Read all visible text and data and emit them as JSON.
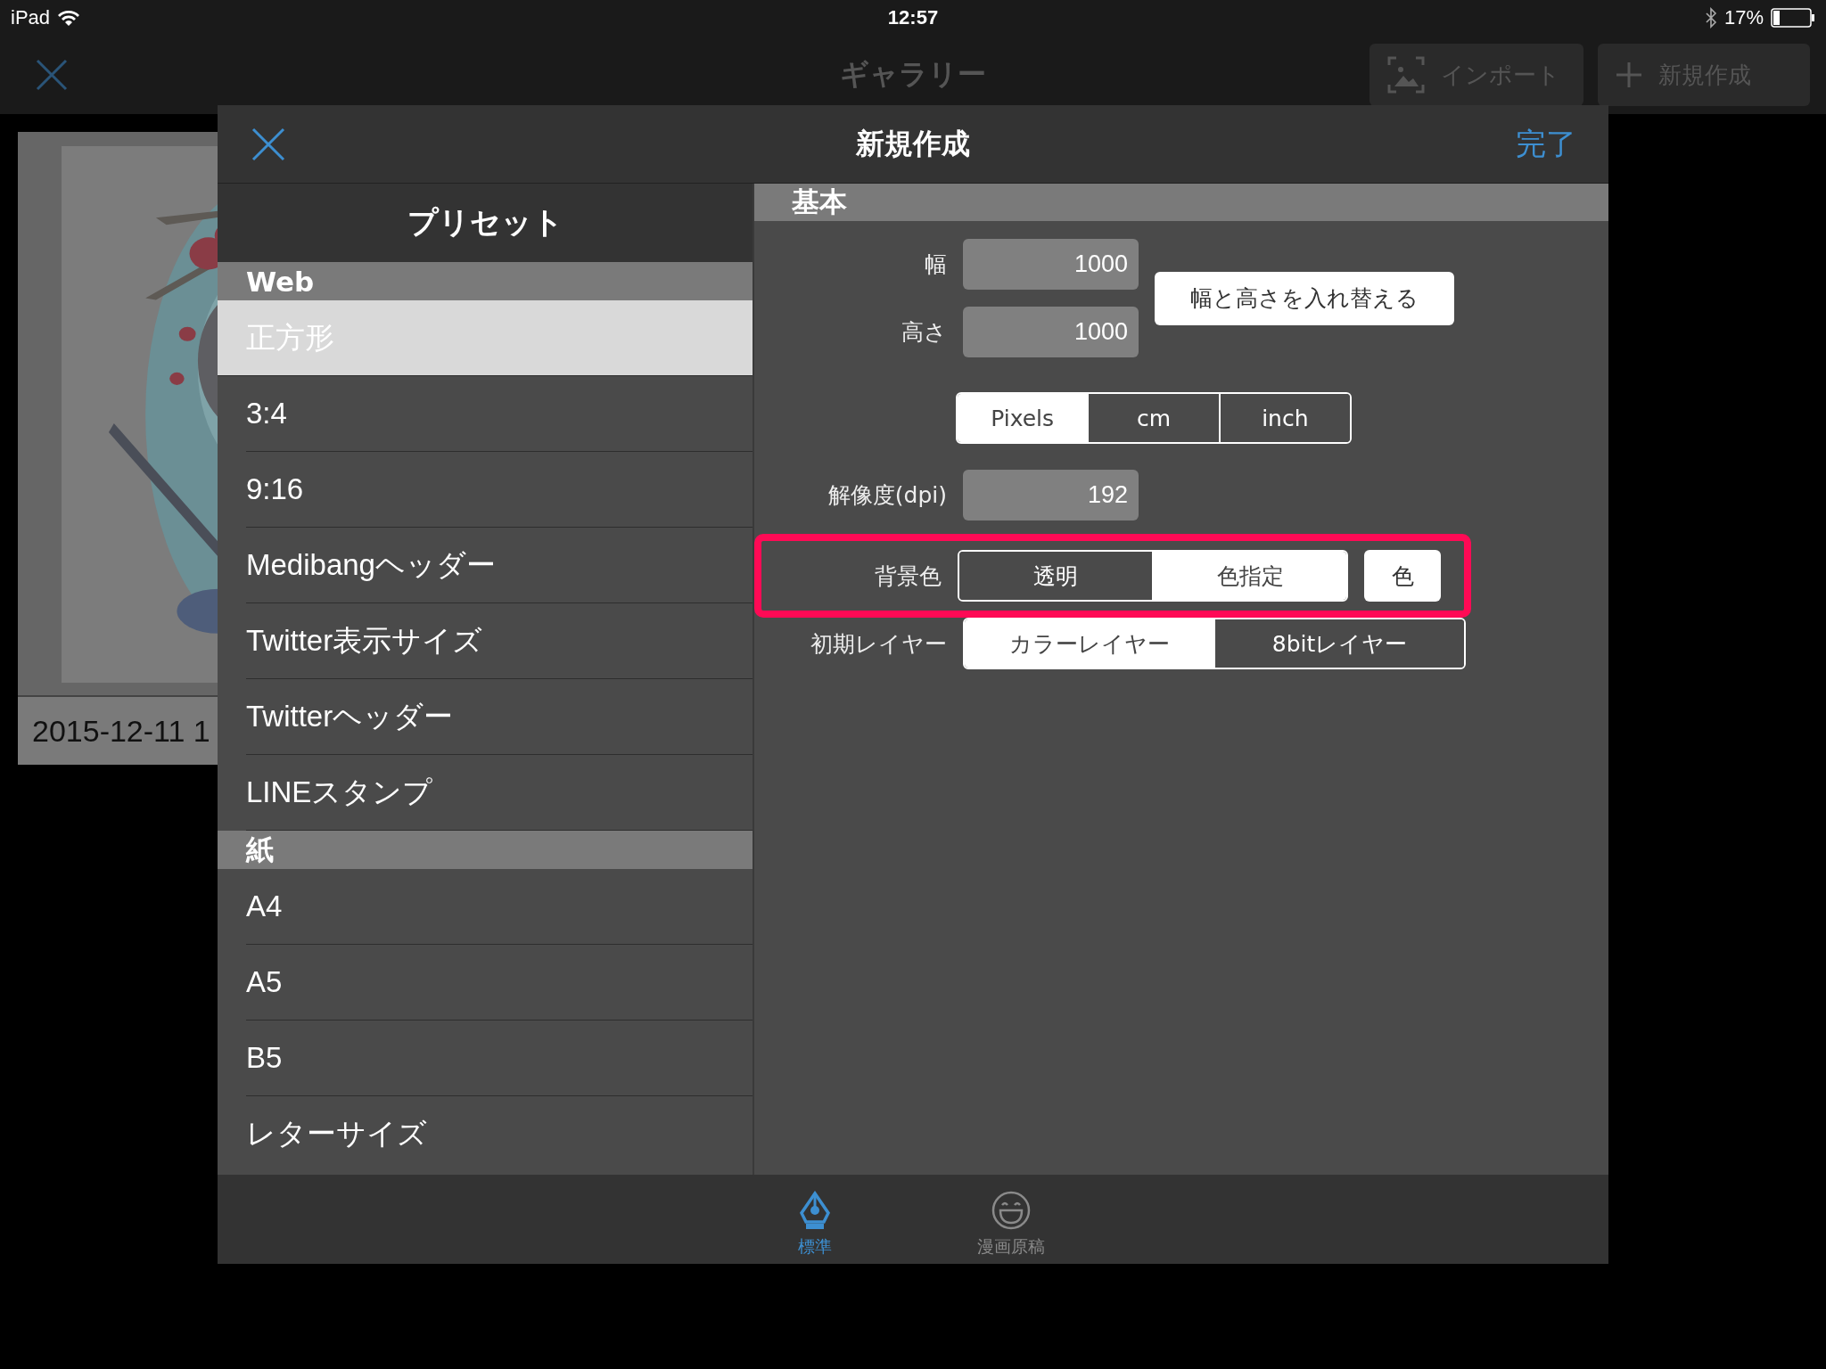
{
  "status_bar": {
    "carrier": "iPad",
    "time": "12:57",
    "battery": "17%"
  },
  "nav": {
    "title": "ギャラリー",
    "buttons": [
      {
        "label": "インポート",
        "kind": "import"
      },
      {
        "label": "新規作成",
        "kind": "new"
      }
    ]
  },
  "gallery": [
    {
      "kind": "picture",
      "date": "2015-12-11 1"
    }
  ],
  "dialog": {
    "title": "新規作成",
    "done": "完了",
    "presets": {
      "title": "プリセット",
      "sections": [
        {
          "title": "Web",
          "items": [
            {
              "label": "正方形",
              "selected": true
            },
            {
              "label": "3:4",
              "selected": false
            },
            {
              "label": "9:16",
              "selected": false
            },
            {
              "label": "Medibangヘッダー",
              "selected": false
            },
            {
              "label": "Twitter表示サイズ",
              "selected": false
            },
            {
              "label": "Twitterヘッダー",
              "selected": false
            },
            {
              "label": "LINEスタンプ",
              "selected": false
            }
          ]
        },
        {
          "title": "紙",
          "items": [
            {
              "label": "A4",
              "selected": false
            },
            {
              "label": "A5",
              "selected": false
            },
            {
              "label": "B5",
              "selected": false
            },
            {
              "label": "レターサイズ",
              "selected": false
            }
          ]
        }
      ]
    },
    "basic": {
      "title": "基本",
      "width": {
        "label": "幅",
        "value": "1000"
      },
      "height": {
        "label": "高さ",
        "value": "1000"
      },
      "swap_button": "幅と高さを入れ替える",
      "units": [
        {
          "label": "Pixels",
          "selected": true
        },
        {
          "label": "cm",
          "selected": false
        },
        {
          "label": "inch",
          "selected": false
        }
      ],
      "resolution": {
        "label": "解像度(dpi)",
        "value": "192"
      },
      "background": {
        "label": "背景色",
        "highlighted": true,
        "options": [
          {
            "label": "透明",
            "selected": false
          },
          {
            "label": "色指定",
            "selected": true
          }
        ],
        "color_button": "色"
      },
      "layer": {
        "label": "初期レイヤー",
        "options": [
          {
            "label": "カラーレイヤー",
            "selected": true
          },
          {
            "label": "8bitレイヤー",
            "selected": false
          }
        ]
      }
    },
    "tabs": [
      {
        "label": "標準",
        "kind": "pen",
        "selected": true
      },
      {
        "label": "漫画原稿",
        "kind": "smile",
        "selected": false
      }
    ]
  }
}
